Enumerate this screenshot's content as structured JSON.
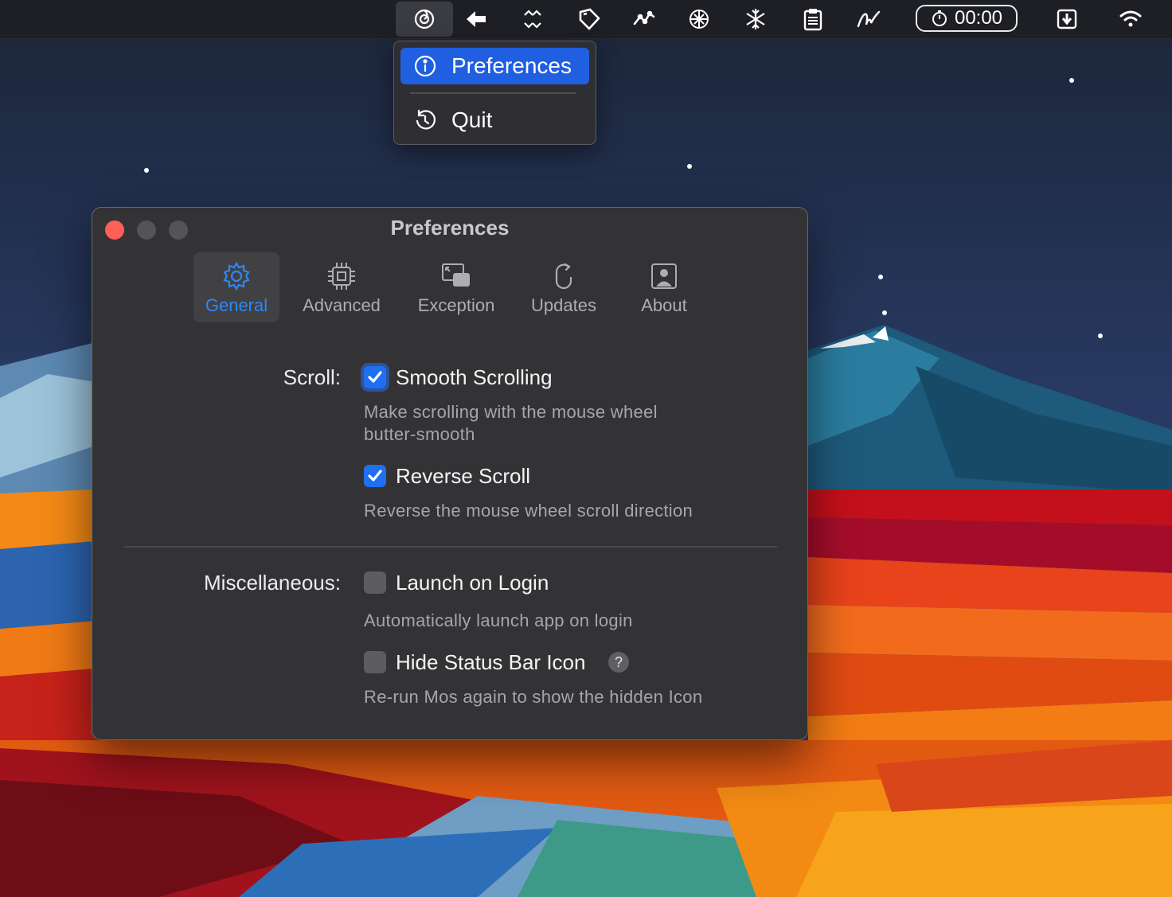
{
  "menubar": {
    "timer": "00:00",
    "icons": [
      "mos-icon",
      "back-arrow-icon",
      "expand-arrows-icon",
      "tag-icon",
      "activity-graph-icon",
      "openai-icon",
      "snowflake-icon",
      "clipboard-icon",
      "signature-icon",
      "stopwatch-icon",
      "download-icon",
      "wifi-icon"
    ]
  },
  "dropdown": {
    "items": [
      {
        "label": "Preferences",
        "icon": "info-icon",
        "selected": true
      },
      {
        "label": "Quit",
        "icon": "restart-icon",
        "selected": false
      }
    ]
  },
  "window": {
    "title": "Preferences",
    "tabs": [
      {
        "label": "General",
        "icon": "gear-icon",
        "active": true
      },
      {
        "label": "Advanced",
        "icon": "cpu-icon",
        "active": false
      },
      {
        "label": "Exception",
        "icon": "windows-icon",
        "active": false
      },
      {
        "label": "Updates",
        "icon": "mouse-refresh-icon",
        "active": false
      },
      {
        "label": "About",
        "icon": "person-icon",
        "active": false
      }
    ],
    "scroll": {
      "label": "Scroll:",
      "smooth": {
        "label": "Smooth Scrolling",
        "checked": true,
        "description": "Make scrolling with the mouse wheel butter-smooth"
      },
      "reverse": {
        "label": "Reverse Scroll",
        "checked": true,
        "description": "Reverse the mouse wheel scroll direction"
      }
    },
    "misc": {
      "label": "Miscellaneous:",
      "launch": {
        "label": "Launch on Login",
        "checked": false,
        "description": "Automatically launch app on login"
      },
      "hide": {
        "label": "Hide Status Bar Icon",
        "checked": false,
        "description": "Re-run Mos again to show the hidden Icon",
        "help": "?"
      }
    }
  },
  "colors": {
    "accent": "#1f6ff2",
    "menu_selected": "#1f5fe0",
    "close": "#fe5f57"
  }
}
